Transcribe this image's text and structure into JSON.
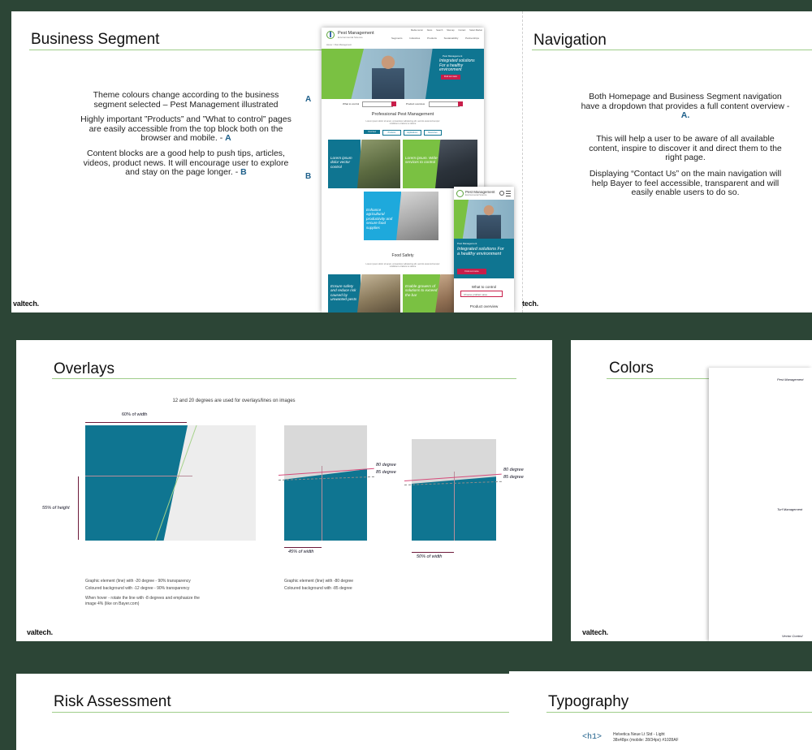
{
  "colors": {
    "background": "#2c4536",
    "accent_green": "#9fcd8a",
    "teal": "#0f7591",
    "blue_letter": "#1d5f8a",
    "crimson": "#c81e4a"
  },
  "business_segment": {
    "title": "Business Segment",
    "p1": "Theme colours change according to the business segment selected – Pest Management illustrated",
    "p2": "Highly important ”Products” and ”What to control” pages are easily accessible from the top block both on the browser and mobile. -",
    "p2_marker": "A",
    "p3": "Content blocks are a good help to push tips, articles, videos, product news. It will encourage user to explore and stay on the page longer. -",
    "p3_marker": "B",
    "side_marker_a": "A",
    "side_marker_b": "B",
    "brand": "valtech."
  },
  "mock_desktop": {
    "logo_text": "Pest Management",
    "logo_sub": "Environmental Science",
    "utility_links": [
      "Media center",
      "News",
      "Search",
      "Sitemap",
      "Contact",
      "Select Market"
    ],
    "nav_links": [
      "Segments",
      "Industries",
      "Products",
      "Sustainability",
      "Partnerships"
    ],
    "breadcrumb": "Home > Pest Management",
    "hero_label": "Pest Management",
    "hero_headline": "Integrated solutions For a healthy environment",
    "hero_button": "Find out more",
    "what_to_control_label": "What to control",
    "product_overview_label": "Product overview",
    "section_title": "Professional Pest Management",
    "section_text": "Lorem ipsum dolor sit amet, consectetur adipiscing elit, sed do eiusmod tempor incididunt ut labore et dolore",
    "tabs": [
      "Overview",
      "Products",
      "Applications",
      "Resources"
    ],
    "card1": "Lorem ipsum dolor vector control",
    "card2": "Lorem ipsum. Wide services to control",
    "card3": "Enhance agricultural productivity and secure food supplies",
    "food_safety_title": "Food Safety",
    "card4": "Ensure safety and reduce risk caused by unwanted pests",
    "card5": "Enable growers of solutions to exceed the bar"
  },
  "mock_mobile": {
    "logo_text": "Pest Management",
    "logo_sub": "Environmental Science",
    "hero_label": "Pest Management",
    "hero_headline": "Integrated solutions For a healthy environment",
    "hero_button": "Find out more",
    "what_to_control_label": "What to control",
    "select_placeholder": "Choose problem area",
    "product_overview_label": "Product overview"
  },
  "navigation": {
    "title": "Navigation",
    "p1": "Both Homepage and Business Segment navigation have a dropdown that provides a full content overview -",
    "p1_marker": "A",
    "p2": "This will help a user to be aware of all available content, inspire to discover it and direct them to the right page.",
    "p3": "Displaying  “Contact Us” on the main navigation will help Bayer to feel accessible, transparent and will easily enable users to do so.",
    "brand_partial": "tech."
  },
  "overlays": {
    "title": "Overlays",
    "subtitle": "12 and 20 degrees are used for overlays/lines on images",
    "label_60_width": "60% of width",
    "label_55_height": "55% of height",
    "label_80_degree_1": "80 degree",
    "label_85_degree_1": "85 degree",
    "label_45_width": "45% of width",
    "label_80_degree_2": "80 degree",
    "label_85_degree_2": "85 degree",
    "label_50_width": "50% of width",
    "note1_a": "Graphic element (line) with -20 degree - 90% transparency",
    "note1_b": "Coloured background with -12 degree - 90% transparency",
    "note1_c": "When hover - rotate the line with -8 degrees and emphasize the image 4% (like on Bayer.com)",
    "note2_a": "Graphic element (line) with -80 degree",
    "note2_b": "Coloured background with -85 degree",
    "brand": "valtech."
  },
  "colors_slide": {
    "title": "Colors",
    "label1": "Pest Management",
    "label2": "Turf Management",
    "label3": "Vector Control",
    "brand": "valtech."
  },
  "risk": {
    "title": "Risk Assessment"
  },
  "typography": {
    "title": "Typography",
    "tag": "<h1>",
    "spec1": "Helvetica Neue Lt Std - Light",
    "spec2": "38x48px (mobile: 28/34px) #1028AF"
  }
}
